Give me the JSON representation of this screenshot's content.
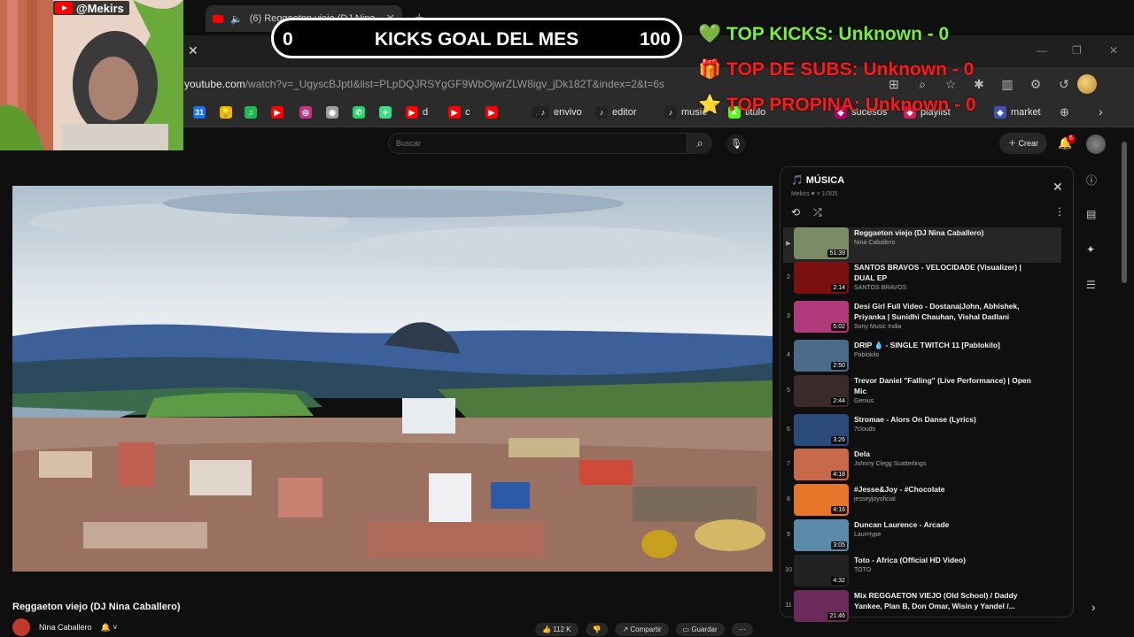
{
  "browser": {
    "tab_title": "(6) Reggaeton viejo (DJ Nina",
    "url_host": "youtube.com",
    "url_path": "/watch?v=_UgyscBJptI&list=PLpDQJRSYgGF9WbOjwrZLW8igv_jDk182T&index=2&t=6s",
    "bookmarks": [
      {
        "label": "",
        "icon": "calendar-icon",
        "color": "#1a73e8"
      },
      {
        "label": "",
        "icon": "bulb-icon",
        "color": "#f4b400"
      },
      {
        "label": "",
        "icon": "spotify-icon",
        "color": "#1db954"
      },
      {
        "label": "",
        "icon": "youtube-icon",
        "color": "#ff0000"
      },
      {
        "label": "",
        "icon": "instagram-icon",
        "color": "#c13584"
      },
      {
        "label": "",
        "icon": "camera-icon",
        "color": "#9e9e9e"
      },
      {
        "label": "",
        "icon": "whatsapp-icon",
        "color": "#25d366"
      },
      {
        "label": "",
        "icon": "plus-icon",
        "color": "#3ddc84"
      },
      {
        "label": "d",
        "icon": "youtube-icon",
        "color": "#ff0000"
      },
      {
        "label": "c",
        "icon": "youtube-icon",
        "color": "#ff0000"
      },
      {
        "label": "",
        "icon": "youtube-icon",
        "color": "#ff0000"
      },
      {
        "label": "",
        "icon": "tiktok-icon",
        "color": "#222222"
      },
      {
        "label": "envivo",
        "icon": "tiktok-icon",
        "color": "#222222"
      },
      {
        "label": "editor",
        "icon": "tiktok-icon",
        "color": "#222222"
      },
      {
        "label": "music",
        "icon": "tiktok-icon",
        "color": "#222222"
      },
      {
        "label": "titulo",
        "icon": "kick-icon",
        "color": "#53fc18"
      },
      {
        "label": "sucesos",
        "icon": "site-icon",
        "color": "#b4006e"
      },
      {
        "label": "playlist",
        "icon": "site-icon",
        "color": "#d81b60"
      },
      {
        "label": "market",
        "icon": "site-icon",
        "color": "#3f51b5"
      }
    ]
  },
  "youtube": {
    "search_placeholder": "Buscar",
    "create_label": "Crear",
    "notifications": "6"
  },
  "video": {
    "title": "Reggaeton viejo (DJ Nina Caballero)",
    "channel": "Nina Caballero",
    "likes": "112 K",
    "share_label": "Compartir",
    "save_label": "Guardar"
  },
  "playlist": {
    "title": "MÚSICA",
    "subtitle": "Mekirs ♥ > 1/305",
    "items": [
      {
        "idx": "▶",
        "title": "Reggaeton viejo (DJ Nina Caballero)",
        "channel": "Nina Caballero",
        "duration": "51:39",
        "thumb": "#7a8c66",
        "active": true
      },
      {
        "idx": "2",
        "title": "SANTOS BRAVOS - VELOCIDADE (Visualizer) | DUAL EP",
        "channel": "SANTOS BRAVOS",
        "duration": "2:14",
        "thumb": "#7a1010"
      },
      {
        "idx": "3",
        "title": "Desi Girl Full Video - Dostana|John, Abhishek, Priyanka | Sunidhi Chauhan, Vishal Dadlani",
        "channel": "Sony Music India",
        "duration": "5:02",
        "thumb": "#b03a7a"
      },
      {
        "idx": "4",
        "title": "DRIP 💧 - SINGLE TWITCH 11 [Pablokilo]",
        "channel": "Pablokilo",
        "duration": "2:50",
        "thumb": "#4a6b8a"
      },
      {
        "idx": "5",
        "title": "Trevor Daniel \"Falling\" (Live Performance) | Open Mic",
        "channel": "Genius",
        "duration": "2:44",
        "thumb": "#3a2a2a"
      },
      {
        "idx": "6",
        "title": "Stromae - Alors On Danse (Lyrics)",
        "channel": "7clouds",
        "duration": "3:26",
        "thumb": "#2a4a7a"
      },
      {
        "idx": "7",
        "title": "Dela",
        "channel": "Johnny Clegg Scatterlings",
        "duration": "4:18",
        "thumb": "#c86a4a"
      },
      {
        "idx": "8",
        "title": "#Jesse&Joy - #Chocolate",
        "channel": "jesseyjoyoficial",
        "duration": "4:16",
        "thumb": "#e8762a"
      },
      {
        "idx": "9",
        "title": "Duncan Laurence - Arcade",
        "channel": "LaurHype",
        "duration": "3:05",
        "thumb": "#5a8aa8"
      },
      {
        "idx": "10",
        "title": "Toto - Africa (Official HD Video)",
        "channel": "TOTO",
        "duration": "4:32",
        "thumb": "#222222"
      },
      {
        "idx": "11",
        "title": "Mix REGGAETON VIEJO (Old School) / Daddy Yankee, Plan B, Don Omar, Wisin y Yandel /...",
        "channel": "",
        "duration": "21:46",
        "thumb": "#6a2a5a"
      }
    ]
  },
  "overlay": {
    "channel": "@Mekirs",
    "goal_current": "0",
    "goal_label": "KICKS GOAL DEL MES",
    "goal_target": "100",
    "top_kicks": "TOP KICKS: Unknown - 0",
    "top_subs": "TOP DE SUBS: Unknown - 0",
    "top_tips": "TOP PROPINA: Unknown - 0"
  }
}
